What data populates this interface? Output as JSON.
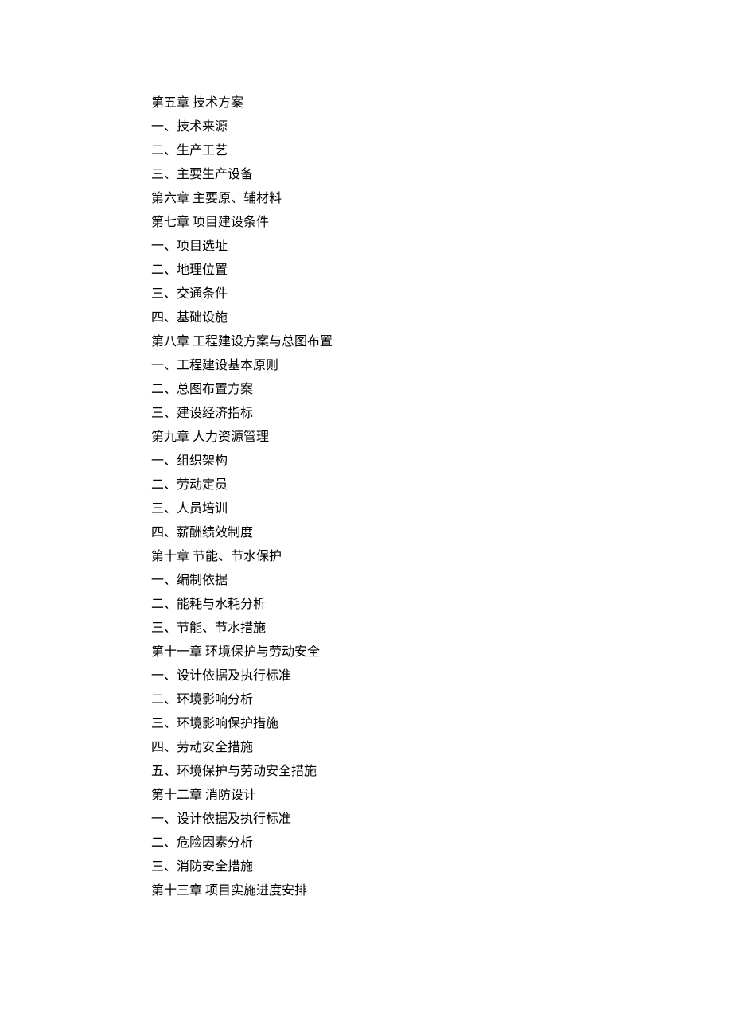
{
  "toc": {
    "lines": [
      "第五章 技术方案",
      "一、技术来源",
      "二、生产工艺",
      "三、主要生产设备",
      "第六章 主要原、辅材料",
      "第七章 项目建设条件",
      "一、项目选址",
      "二、地理位置",
      "三、交通条件",
      "四、基础设施",
      "第八章 工程建设方案与总图布置",
      "一、工程建设基本原则",
      "二、总图布置方案",
      "三、建设经济指标",
      "第九章 人力资源管理",
      "一、组织架构",
      "二、劳动定员",
      "三、人员培训",
      "四、薪酬绩效制度",
      "第十章 节能、节水保护",
      "一、编制依据",
      "二、能耗与水耗分析",
      "三、节能、节水措施",
      "第十一章 环境保护与劳动安全",
      "一、设计依据及执行标准",
      "二、环境影响分析",
      "三、环境影响保护措施",
      "四、劳动安全措施",
      "五、环境保护与劳动安全措施",
      "第十二章 消防设计",
      "一、设计依据及执行标准",
      "二、危险因素分析",
      "三、消防安全措施",
      "第十三章 项目实施进度安排"
    ]
  }
}
